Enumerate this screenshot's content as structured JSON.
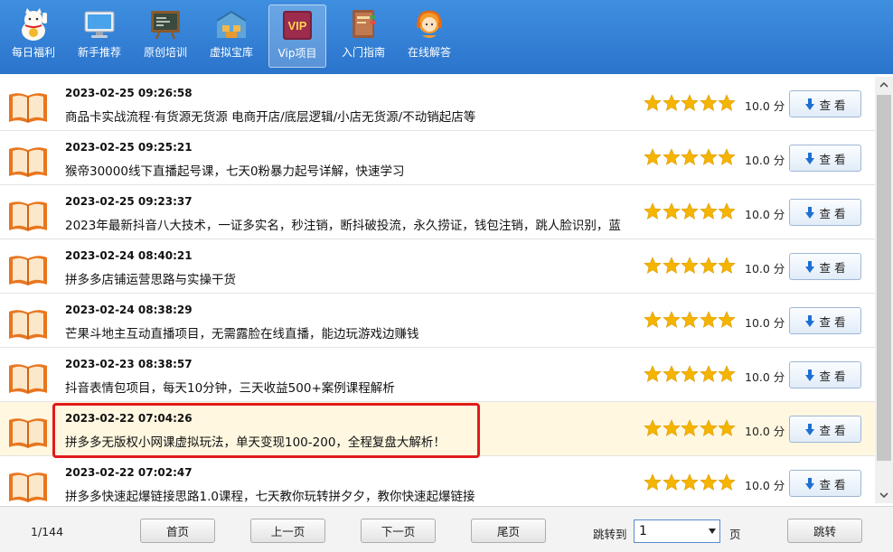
{
  "toolbar": {
    "items": [
      {
        "label": "每日福利",
        "icon": "lucky-cat-icon"
      },
      {
        "label": "新手推荐",
        "icon": "monitor-icon"
      },
      {
        "label": "原创培训",
        "icon": "blackboard-icon"
      },
      {
        "label": "虚拟宝库",
        "icon": "warehouse-icon"
      },
      {
        "label": "Vip项目",
        "icon": "vip-icon",
        "badge": "VIP",
        "active": true
      },
      {
        "label": "入门指南",
        "icon": "guide-book-icon"
      },
      {
        "label": "在线解答",
        "icon": "support-agent-icon"
      }
    ]
  },
  "rows": [
    {
      "date": "2023-02-25 09:26:58",
      "title": "商品卡实战流程·有货源无货源 电商开店/底层逻辑/小店无货源/不动销起店等",
      "score": "10.0 分",
      "button": "查 看"
    },
    {
      "date": "2023-02-25 09:25:21",
      "title": "猴帝30000线下直播起号课，七天0粉暴力起号详解，快速学习",
      "score": "10.0 分",
      "button": "查 看"
    },
    {
      "date": "2023-02-25 09:23:37",
      "title": "2023年最新抖音八大技术，一证多实名，秒注销，断抖破投流，永久捞证，钱包注销，跳人脸识别，蓝",
      "score": "10.0 分",
      "button": "查 看"
    },
    {
      "date": "2023-02-24 08:40:21",
      "title": "拼多多店铺运营思路与实操干货",
      "score": "10.0 分",
      "button": "查 看"
    },
    {
      "date": "2023-02-24 08:38:29",
      "title": "芒果斗地主互动直播项目，无需露脸在线直播，能边玩游戏边赚钱",
      "score": "10.0 分",
      "button": "查 看"
    },
    {
      "date": "2023-02-23 08:38:57",
      "title": "抖音表情包项目，每天10分钟，三天收益500+案例课程解析",
      "score": "10.0 分",
      "button": "查 看"
    },
    {
      "date": "2023-02-22 07:04:26",
      "title": "拼多多无版权小网课虚拟玩法，单天变现100-200，全程复盘大解析！",
      "score": "10.0 分",
      "button": "查 看"
    },
    {
      "date": "2023-02-22 07:02:47",
      "title": "拼多多快速起爆链接思路1.0课程，七天教你玩转拼夕夕，教你快速起爆链接",
      "score": "10.0 分",
      "button": "查 看"
    }
  ],
  "rating": {
    "stars": 5,
    "max": 5
  },
  "highlighted_row": 6,
  "footer": {
    "page_info": "1/144",
    "first": "首页",
    "prev": "上一页",
    "next": "下一页",
    "last": "尾页",
    "jump_label": "跳转到",
    "jump_value": "1",
    "page_unit": "页",
    "jump_button": "跳转"
  },
  "colors": {
    "toolbar": "#2b74cc",
    "star": "#f5b400",
    "book": "#e8761f",
    "highlight_row": "#fff7e0",
    "annotation_box": "#e21b1b",
    "view_arrow": "#1e6fd2"
  }
}
